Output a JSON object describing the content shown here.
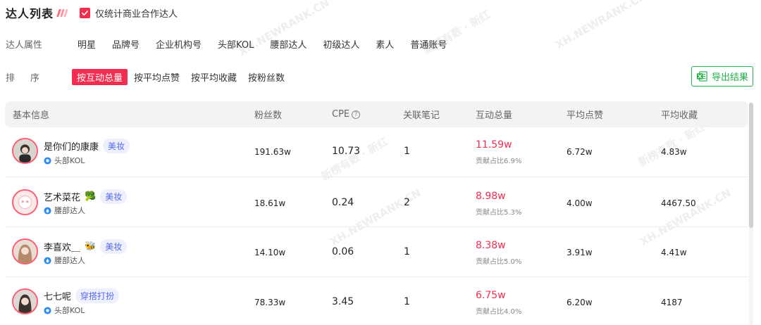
{
  "header": {
    "title": "达人列表",
    "commercial_only_label": "仅统计商业合作达人",
    "commercial_only_checked": true
  },
  "filters": {
    "label": "达人属性",
    "items": [
      "明星",
      "品牌号",
      "企业机构号",
      "头部KOL",
      "腰部达人",
      "初级达人",
      "素人",
      "普通账号"
    ]
  },
  "sort": {
    "label": "排序",
    "items": [
      "按互动总量",
      "按平均点赞",
      "按平均收藏",
      "按粉丝数"
    ],
    "active": "按互动总量"
  },
  "export": {
    "label": "导出结果"
  },
  "table": {
    "columns": [
      "基本信息",
      "粉丝数",
      "CPE",
      "关联笔记",
      "互动总量",
      "平均点赞",
      "平均收藏"
    ],
    "rows": [
      {
        "name": "是你们的康康",
        "emoji": "",
        "tag": "美妆",
        "level": "头部KOL",
        "fans": "191.63w",
        "cpe": "10.73",
        "notes": "1",
        "interactions": "11.59w",
        "contribution": "贡献占比6.9%",
        "avg_likes": "6.72w",
        "avg_favorites": "4.83w"
      },
      {
        "name": "艺术菜花",
        "emoji": "🥦",
        "tag": "美妆",
        "level": "腰部达人",
        "fans": "18.61w",
        "cpe": "0.24",
        "notes": "2",
        "interactions": "8.98w",
        "contribution": "贡献占比5.3%",
        "avg_likes": "4.00w",
        "avg_favorites": "4467.50"
      },
      {
        "name": "李喜欢＿",
        "emoji": "🐝",
        "tag": "美妆",
        "level": "腰部达人",
        "fans": "14.10w",
        "cpe": "0.06",
        "notes": "1",
        "interactions": "8.38w",
        "contribution": "贡献占比5.0%",
        "avg_likes": "3.91w",
        "avg_favorites": "4.41w"
      },
      {
        "name": "七七呢",
        "emoji": "",
        "tag": "穿搭打扮",
        "level": "头部KOL",
        "fans": "78.33w",
        "cpe": "3.45",
        "notes": "1",
        "interactions": "6.75w",
        "contribution": "贡献占比4.0%",
        "avg_likes": "6.20w",
        "avg_favorites": "4187"
      }
    ]
  },
  "watermark_text": [
    "XH.NEWRANK.CN",
    "新榜有数 · 新红"
  ],
  "colors": {
    "accent": "#f22d50",
    "tag_text": "#5467f0",
    "tag_bg": "#eef0fe",
    "export_green": "#1eaf47",
    "header_bg": "#f1f3f4"
  },
  "icons": {
    "checkbox": "checkmark-icon",
    "export": "excel-icon",
    "cpe_help": "question-circle-icon",
    "level_head": "kol-badge-icon",
    "level_waist": "drop-badge-icon"
  }
}
